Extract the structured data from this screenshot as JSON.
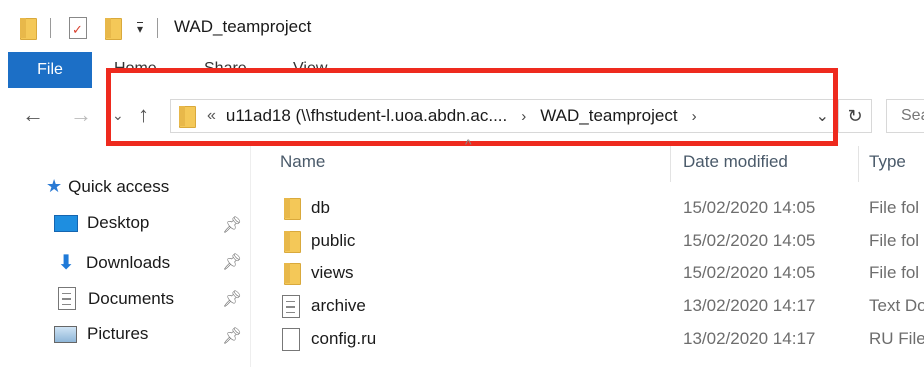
{
  "window": {
    "title": "WAD_teamproject"
  },
  "ribbon": {
    "tabs": [
      "File",
      "Home",
      "Share",
      "View"
    ]
  },
  "address_bar": {
    "overflow": "«",
    "crumbs": [
      "u11ad18 (\\\\fhstudent-l.uoa.abdn.ac....",
      "WAD_teamproject"
    ],
    "chevron": "›",
    "dropdown": "⌄",
    "refresh": "↻"
  },
  "search": {
    "placeholder": "Sea"
  },
  "sidebar": {
    "quick_access": "Quick access",
    "items": [
      {
        "label": "Desktop",
        "icon": "desktop-icon"
      },
      {
        "label": "Downloads",
        "icon": "downloads-icon"
      },
      {
        "label": "Documents",
        "icon": "documents-icon"
      },
      {
        "label": "Pictures",
        "icon": "pictures-icon"
      }
    ]
  },
  "columns": {
    "name": "Name",
    "date": "Date modified",
    "type": "Type"
  },
  "files": [
    {
      "name": "db",
      "date": "15/02/2020 14:05",
      "type": "File fol",
      "icon": "folder-icon"
    },
    {
      "name": "public",
      "date": "15/02/2020 14:05",
      "type": "File fol",
      "icon": "folder-icon"
    },
    {
      "name": "views",
      "date": "15/02/2020 14:05",
      "type": "File fol",
      "icon": "folder-icon"
    },
    {
      "name": "archive",
      "date": "13/02/2020 14:17",
      "type": "Text Do",
      "icon": "text-file-icon"
    },
    {
      "name": "config.ru",
      "date": "13/02/2020 14:17",
      "type": "RU File",
      "icon": "file-icon"
    }
  ],
  "colors": {
    "file_tab": "#1c6fc6",
    "highlight": "#ee2a1e",
    "folder": "#f4c858"
  }
}
